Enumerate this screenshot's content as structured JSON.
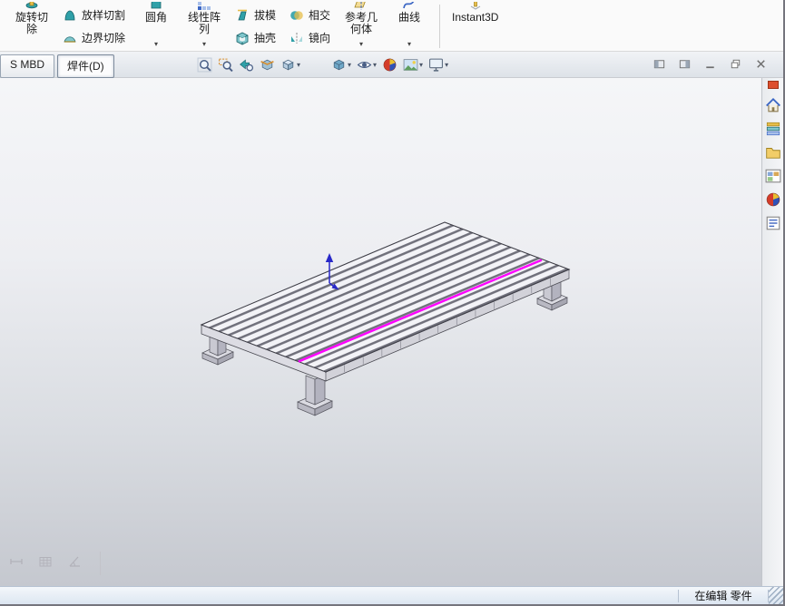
{
  "ribbon": {
    "items": [
      {
        "type": "big",
        "name": "revolved-cut",
        "label_lines": [
          "旋转切",
          "除"
        ]
      },
      {
        "type": "stack",
        "items": [
          {
            "name": "lofted-cut",
            "label": "放样切割"
          },
          {
            "name": "boundary-cut",
            "label": "边界切除"
          }
        ]
      },
      {
        "type": "big-drop",
        "name": "fillet",
        "label_lines": [
          "圆角"
        ]
      },
      {
        "type": "big-drop",
        "name": "linear-pattern",
        "label_lines": [
          "线性阵",
          "列"
        ]
      },
      {
        "type": "stack",
        "items": [
          {
            "name": "draft",
            "label": "拔模"
          },
          {
            "name": "shell",
            "label": "抽壳"
          }
        ]
      },
      {
        "type": "stack",
        "items": [
          {
            "name": "intersect",
            "label": "相交"
          },
          {
            "name": "mirror",
            "label": "镜向"
          }
        ]
      },
      {
        "type": "big-drop",
        "name": "reference-geometry",
        "label_lines": [
          "参考几",
          "何体"
        ]
      },
      {
        "type": "big-drop",
        "name": "curves",
        "label_lines": [
          "曲线"
        ]
      },
      {
        "type": "separator"
      },
      {
        "type": "big",
        "name": "instant3d",
        "label_lines": [
          "Instant3D"
        ]
      }
    ]
  },
  "tabs": {
    "items": [
      {
        "name": "mbd",
        "label": "S MBD",
        "active": false
      },
      {
        "name": "weldments",
        "label": "焊件(D)",
        "active": true
      }
    ]
  },
  "view_toolbar": {
    "items": [
      {
        "name": "zoom-fit",
        "dropdown": false
      },
      {
        "name": "zoom-area",
        "dropdown": false
      },
      {
        "name": "previous-view",
        "dropdown": false
      },
      {
        "name": "section-view",
        "dropdown": false
      },
      {
        "name": "view-orientation",
        "dropdown": true
      },
      {
        "name": "display-style",
        "dropdown": true,
        "group_start": true
      },
      {
        "name": "hide-show-items",
        "dropdown": true
      },
      {
        "name": "edit-appearance",
        "dropdown": false
      },
      {
        "name": "apply-scene",
        "dropdown": true
      },
      {
        "name": "view-settings",
        "dropdown": true
      }
    ]
  },
  "window_controls": {
    "items": [
      {
        "name": "dock-left"
      },
      {
        "name": "dock-right"
      },
      {
        "name": "minimize"
      },
      {
        "name": "maximize"
      },
      {
        "name": "close"
      }
    ]
  },
  "task_pane": {
    "items": [
      {
        "name": "home"
      },
      {
        "name": "design-library"
      },
      {
        "name": "file-explorer"
      },
      {
        "name": "view-palette"
      },
      {
        "name": "appearances"
      },
      {
        "name": "custom-properties"
      }
    ]
  },
  "viewport": {
    "selection_color": "#FF00FF",
    "triad_color": "#2828C8",
    "bottom_icons": [
      {
        "name": "dimension"
      },
      {
        "name": "grid"
      },
      {
        "name": "angle"
      }
    ]
  },
  "status_bar": {
    "text": "在编辑 零件"
  }
}
